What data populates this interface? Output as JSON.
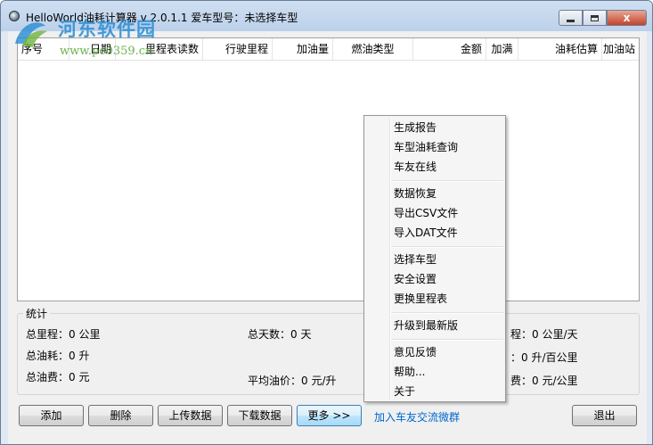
{
  "window": {
    "title": "HelloWorld油耗计算器 v 2.0.1.1   爱车型号：未选择车型",
    "min_icon": "minimize-icon",
    "max_icon": "maximize-icon",
    "close_icon": "close-icon",
    "close_glyph": "x"
  },
  "watermark": {
    "name": "河东软件园",
    "url": "www.pc0359.cn"
  },
  "table": {
    "columns": [
      "序号",
      "日期",
      "里程表读数",
      "行驶里程",
      "加油量",
      "燃油类型",
      "金额",
      "加满",
      "油耗估算",
      "加油站"
    ],
    "rows": []
  },
  "stats": {
    "legend": "统计",
    "total_mileage": "总里程：0 公里",
    "total_days": "总天数：0 天",
    "total_fuel": "总油耗：0 升",
    "total_cost": "总油费：0 元",
    "avg_price": "平均油价：0 元/升",
    "daily_mileage_partial": "程：0 公里/天",
    "per_100km": "：0 升/百公里",
    "per_km_cost": "费：0 元/公里"
  },
  "buttons": {
    "add": "添加",
    "delete": "删除",
    "upload": "上传数据",
    "download": "下载数据",
    "more": "更多 >>",
    "join_group": "加入车友交流微群",
    "exit": "退出"
  },
  "context_menu": {
    "generate_report": "生成报告",
    "model_fuel_query": "车型油耗查询",
    "friends_online": "车友在线",
    "data_restore": "数据恢复",
    "export_csv": "导出CSV文件",
    "import_dat": "导入DAT文件",
    "select_model": "选择车型",
    "security_settings": "安全设置",
    "change_odometer": "更换里程表",
    "upgrade": "升级到最新版",
    "feedback": "意见反馈",
    "help": "帮助...",
    "about": "关于"
  },
  "colors": {
    "window_bg": "#f0f0f0",
    "titlebar": "#c6d9ef",
    "link": "#0066cc",
    "close_button": "#c2432b"
  }
}
